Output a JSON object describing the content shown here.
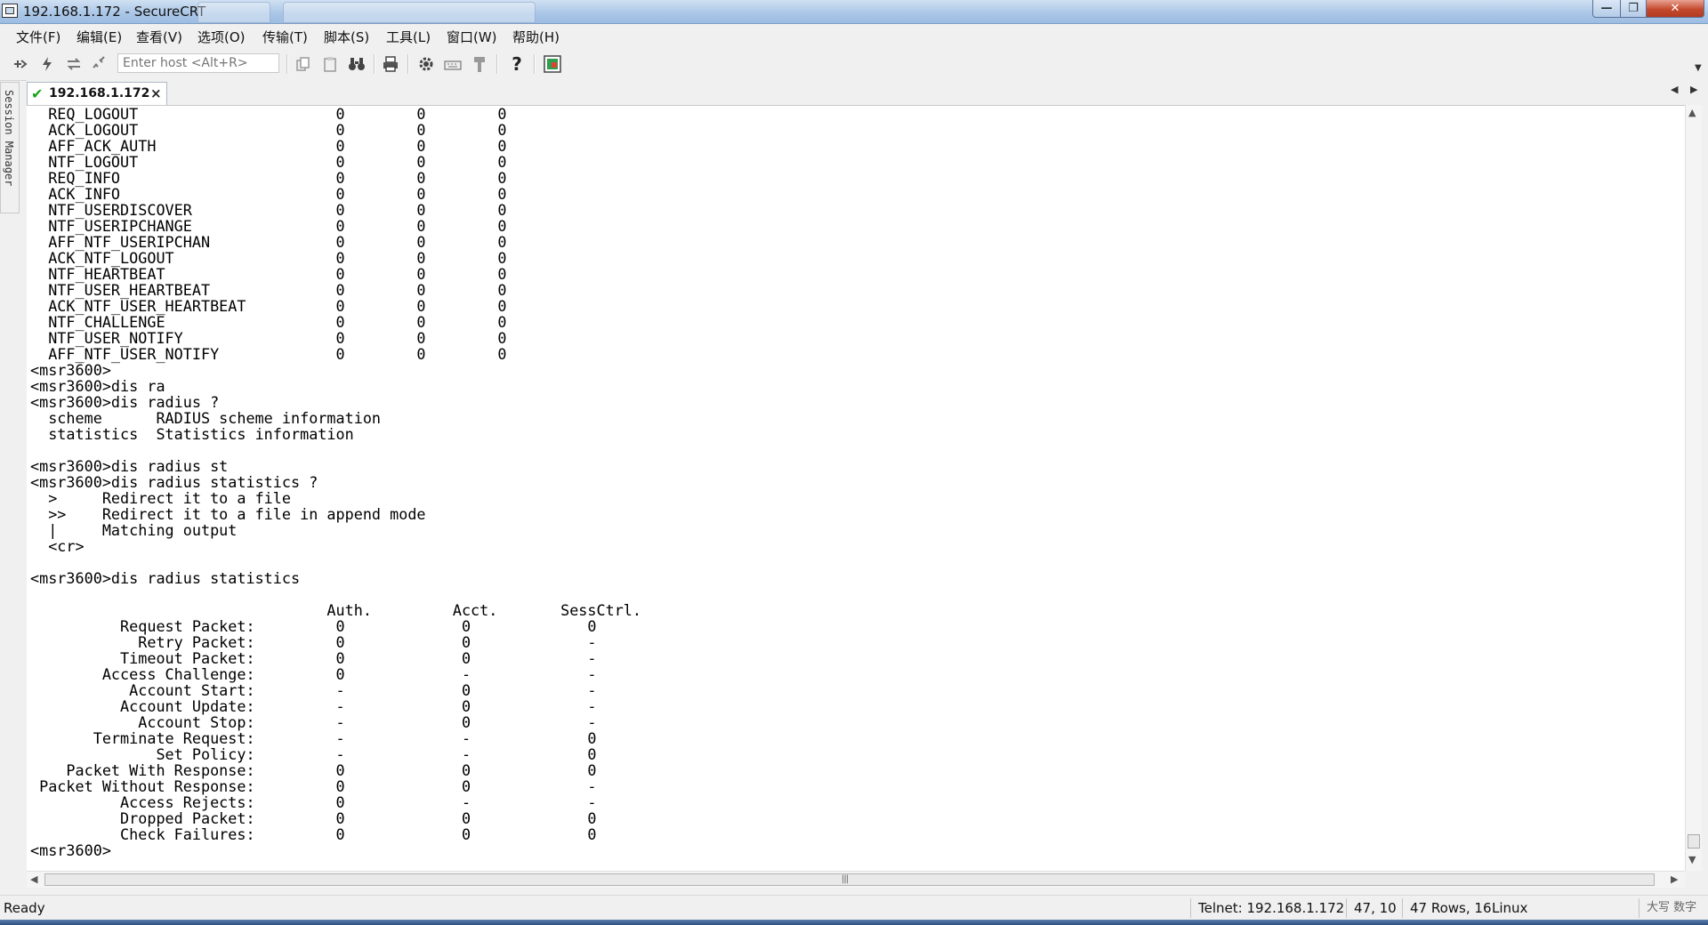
{
  "window": {
    "title": "192.168.1.172 - SecureCRT",
    "minimize": "—",
    "maximize": "❐",
    "close": "✕"
  },
  "menu": [
    "文件(F)",
    "编辑(E)",
    "查看(V)",
    "选项(O)",
    "传输(T)",
    "脚本(S)",
    "工具(L)",
    "窗口(W)",
    "帮助(H)"
  ],
  "toolbar": {
    "host_placeholder": "Enter host <Alt+R>",
    "help_glyph": "?"
  },
  "session_manager": {
    "label": "Session Manager"
  },
  "tab": {
    "label": "192.168.1.172",
    "close": "×",
    "check": "✔"
  },
  "terminal": {
    "lines": [
      "  REQ_LOGOUT                      0        0        0",
      "  ACK_LOGOUT                      0        0        0",
      "  AFF_ACK_AUTH                    0        0        0",
      "  NTF_LOGOUT                      0        0        0",
      "  REQ_INFO                        0        0        0",
      "  ACK_INFO                        0        0        0",
      "  NTF_USERDISCOVER                0        0        0",
      "  NTF_USERIPCHANGE                0        0        0",
      "  AFF_NTF_USERIPCHAN              0        0        0",
      "  ACK_NTF_LOGOUT                  0        0        0",
      "  NTF_HEARTBEAT                   0        0        0",
      "  NTF_USER_HEARTBEAT              0        0        0",
      "  ACK_NTF_USER_HEARTBEAT          0        0        0",
      "  NTF_CHALLENGE                   0        0        0",
      "  NTF_USER_NOTIFY                 0        0        0",
      "  AFF_NTF_USER_NOTIFY             0        0        0",
      "<msr3600>",
      "<msr3600>dis ra",
      "<msr3600>dis radius ?",
      "  scheme      RADIUS scheme information",
      "  statistics  Statistics information",
      "",
      "<msr3600>dis radius st",
      "<msr3600>dis radius statistics ?",
      "  >     Redirect it to a file",
      "  >>    Redirect it to a file in append mode",
      "  |     Matching output",
      "  <cr>",
      "",
      "<msr3600>dis radius statistics",
      "",
      "                                 Auth.         Acct.       SessCtrl.",
      "          Request Packet:         0             0             0",
      "            Retry Packet:         0             0             -",
      "          Timeout Packet:         0             0             -",
      "        Access Challenge:         0             -             -",
      "           Account Start:         -             0             -",
      "          Account Update:         -             0             -",
      "            Account Stop:         -             0             -",
      "       Terminate Request:         -             -             0",
      "              Set Policy:         -             -             0",
      "    Packet With Response:         0             0             0",
      " Packet Without Response:         0             0             -",
      "          Access Rejects:         0             -             -",
      "          Dropped Packet:         0             0             0",
      "          Check Failures:         0             0             0",
      "<msr3600>"
    ]
  },
  "status": {
    "ready": "Ready",
    "connection": "Telnet: 192.168.1.172",
    "cursor": "47,  10",
    "size": "47 Rows, 16",
    "os": "Linux",
    "ime": "大写  数字"
  }
}
